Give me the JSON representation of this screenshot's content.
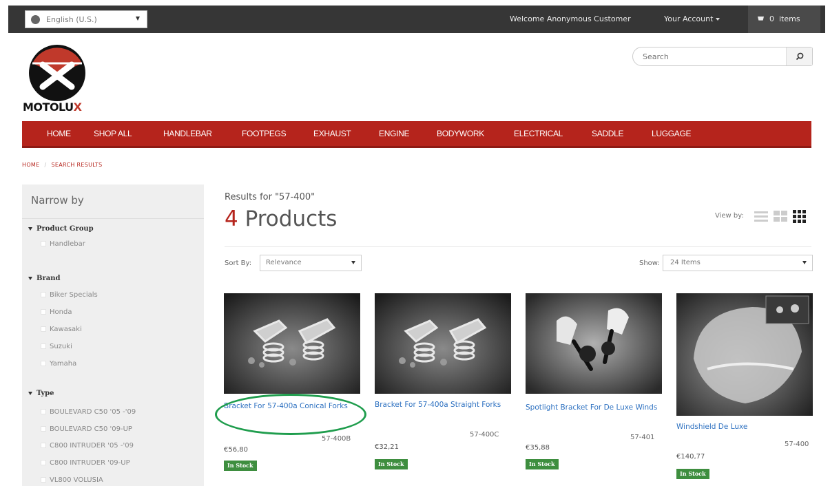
{
  "topbar": {
    "language": "English (U.S.)",
    "welcome": "Welcome Anonymous Customer",
    "account": "Your Account",
    "cart_count": "0",
    "cart_label": "items"
  },
  "logo": {
    "text_dark": "MOTOLU",
    "text_red": "X"
  },
  "search": {
    "placeholder": "Search"
  },
  "nav": [
    "HOME",
    "SHOP ALL",
    "HANDLEBAR",
    "FOOTPEGS",
    "EXHAUST",
    "ENGINE",
    "BODYWORK",
    "ELECTRICAL",
    "SADDLE",
    "LUGGAGE"
  ],
  "breadcrumb": [
    "HOME",
    "SEARCH RESULTS"
  ],
  "sidebar": {
    "title": "Narrow by",
    "groups": [
      {
        "name": "Product Group",
        "items": [
          "Handlebar"
        ]
      },
      {
        "name": "Brand",
        "items": [
          "Biker Specials",
          "Honda",
          "Kawasaki",
          "Suzuki",
          "Yamaha"
        ]
      },
      {
        "name": "Type",
        "items": [
          "BOULEVARD C50 '05 -'09",
          "BOULEVARD C50 '09-UP",
          "C800 INTRUDER '05 -'09",
          "C800 INTRUDER '09-UP",
          "VL800 VOLUSIA"
        ]
      }
    ]
  },
  "results": {
    "query_line": "Results for \"57-400\"",
    "count": "4",
    "count_label": "Products",
    "view_by": "View by:",
    "sort_label": "Sort By:",
    "sort_value": "Relevance",
    "show_label": "Show:",
    "show_value": "24 Items"
  },
  "products": [
    {
      "title": "Bracket For 57-400a Conical Forks",
      "sku": "57-400B",
      "price": "€56,80",
      "stock": "In Stock"
    },
    {
      "title": "Bracket For 57-400a Straight Forks",
      "sku": "57-400C",
      "price": "€32,21",
      "stock": "In Stock"
    },
    {
      "title": "Spotlight Bracket For De Luxe Winds",
      "sku": "57-401",
      "price": "€35,88",
      "stock": "In Stock"
    },
    {
      "title": "Windshield De Luxe",
      "sku": "57-400",
      "price": "€140,77",
      "stock": "In Stock"
    }
  ],
  "colors": {
    "brand_red": "#b5241c",
    "link_blue": "#2f72c1",
    "stock_green": "#3e8e3f",
    "annotation_green": "#1f9d4d"
  }
}
